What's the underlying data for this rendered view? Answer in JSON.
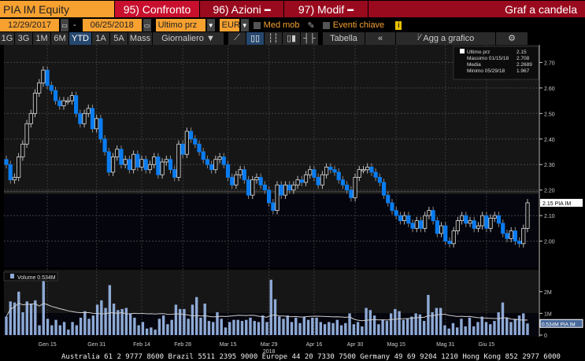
{
  "header": {
    "ticker": "PIA IM Equity",
    "confronto": "95) Confronto",
    "azioni": "96) Azioni",
    "modif": "97) Modif",
    "title": "Graf a candela"
  },
  "controls": {
    "start_date": "12/29/2017",
    "dash": "-",
    "end_date": "06/25/2018",
    "price_field": "Ultimo prz",
    "currency": "EUR",
    "med_mob": "Med mob",
    "eventi": "Eventi chiave",
    "info": "i"
  },
  "periods": [
    "1G",
    "3G",
    "1M",
    "6M",
    "YTD",
    "1A",
    "5A",
    "Mass"
  ],
  "active_period": "YTD",
  "frequency": "Giornaliero ▼",
  "toolbar": {
    "tabella": "Tabella",
    "collapse": "«",
    "add": "Agg a grafico",
    "gear": "⚙"
  },
  "colors": {
    "down": "#0a7cf0",
    "up": "#dddddd",
    "volume": "#8eaad6"
  },
  "legend": {
    "rows": [
      [
        "Ultimo prz",
        "2.15"
      ],
      [
        "Massimo 01/15/18",
        "2.708"
      ],
      [
        "Media",
        "2.2689"
      ],
      [
        "Minimo 05/29/18",
        "1.967"
      ]
    ]
  },
  "volume_legend": "Volume 0.534M",
  "footer": "Australia 61 2 9777 8600 Brazil 5511 2395 9000 Europe 44 20 7330 7500 Germany 49 69 9204 1210 Hong Kong 852 2977 6000",
  "chart_data": {
    "type": "candlestick",
    "ylim": [
      1.897,
      2.769
    ],
    "yticks": [
      "2.00",
      "2.10",
      "2.20",
      "2.30",
      "2.40",
      "2.50",
      "2.60",
      "2.70"
    ],
    "last_label": "2.15 PIA IM",
    "last_value": 2.15,
    "xticks": [
      {
        "label": "Gen 15",
        "i": 10
      },
      {
        "label": "Gen 31",
        "i": 22
      },
      {
        "label": "Feb 14",
        "i": 33
      },
      {
        "label": "Feb 28",
        "i": 43
      },
      {
        "label": "Mar 15",
        "i": 54
      },
      {
        "label": "Mar 29",
        "i": 64
      },
      {
        "label": "Apr 16",
        "i": 75
      },
      {
        "label": "Apr 30",
        "i": 85
      },
      {
        "label": "Mag 15",
        "i": 95
      },
      {
        "label": "Mag 31",
        "i": 107
      },
      {
        "label": "Giu 15",
        "i": 117
      }
    ],
    "year_label": "2018",
    "close": [
      2.3,
      2.24,
      2.25,
      2.33,
      2.38,
      2.46,
      2.5,
      2.58,
      2.62,
      2.67,
      2.61,
      2.59,
      2.55,
      2.53,
      2.55,
      2.55,
      2.57,
      2.5,
      2.46,
      2.5,
      2.52,
      2.44,
      2.48,
      2.4,
      2.35,
      2.27,
      2.33,
      2.36,
      2.3,
      2.32,
      2.28,
      2.34,
      2.29,
      2.32,
      2.28,
      2.3,
      2.33,
      2.26,
      2.31,
      2.32,
      2.28,
      2.25,
      2.38,
      2.34,
      2.43,
      2.4,
      2.38,
      2.35,
      2.32,
      2.3,
      2.28,
      2.32,
      2.33,
      2.3,
      2.25,
      2.22,
      2.26,
      2.28,
      2.24,
      2.18,
      2.24,
      2.25,
      2.22,
      2.2,
      2.15,
      2.12,
      2.22,
      2.18,
      2.22,
      2.2,
      2.22,
      2.24,
      2.23,
      2.26,
      2.28,
      2.25,
      2.22,
      2.26,
      2.29,
      2.28,
      2.27,
      2.24,
      2.22,
      2.2,
      2.17,
      2.25,
      2.28,
      2.28,
      2.29,
      2.27,
      2.25,
      2.23,
      2.18,
      2.15,
      2.12,
      2.1,
      2.08,
      2.1,
      2.07,
      2.05,
      2.08,
      2.05,
      2.1,
      2.12,
      2.08,
      2.03,
      2.06,
      2.0,
      1.99,
      2.04,
      2.08,
      2.1,
      2.07,
      2.08,
      2.05,
      2.06,
      2.1,
      2.05,
      2.09,
      2.1,
      2.07,
      2.03,
      2.01,
      2.04,
      2.0,
      1.99,
      2.05,
      2.15
    ],
    "volume_ylim": [
      0,
      2.9
    ],
    "volume_ticks": [
      "0",
      "1M",
      "2M"
    ],
    "volume_last_label": "0.534M PIA IM",
    "volume_m": [
      0.85,
      1.55,
      1.5,
      2.0,
      1.05,
      1.55,
      1.45,
      1.6,
      0.45,
      2.6,
      0.75,
      0.45,
      0.7,
      0.45,
      0.6,
      0.25,
      0.6,
      0.45,
      0.8,
      1.1,
      0.75,
      0.9,
      1.4,
      1.6,
      1.25,
      2.3,
      1.45,
      1.15,
      1.2,
      1.25,
      1.0,
      0.8,
      0.45,
      0.6,
      0.3,
      0.35,
      0.25,
      0.75,
      0.9,
      0.5,
      0.7,
      1.4,
      1.2,
      1.2,
      0.75,
      1.4,
      1.75,
      0.8,
      1.45,
      0.65,
      0.6,
      1.05,
      0.75,
      0.35,
      0.6,
      0.7,
      0.7,
      0.65,
      0.7,
      0.8,
      0.65,
      0.6,
      0.9,
      0.6,
      2.55,
      1.65,
      0.85,
      0.75,
      0.9,
      0.6,
      0.8,
      0.55,
      0.85,
      0.7,
      0.8,
      0.8,
      0.6,
      0.5,
      0.6,
      0.55,
      0.7,
      0.45,
      0.55,
      1.0,
      0.5,
      0.6,
      0.4,
      1.25,
      1.15,
      0.9,
      0.5,
      0.7,
      0.65,
      1.0,
      1.2,
      1.1,
      0.7,
      0.75,
      0.85,
      1.0,
      0.95,
      0.65,
      1.85,
      1.05,
      1.25,
      1.25,
      0.45,
      0.3,
      0.55,
      0.35,
      0.75,
      0.4,
      0.8,
      0.4,
      0.6,
      0.85,
      0.6,
      0.5,
      0.65,
      1.05,
      1.5,
      0.8,
      0.6,
      0.75,
      0.9,
      1.0,
      0.534
    ]
  }
}
